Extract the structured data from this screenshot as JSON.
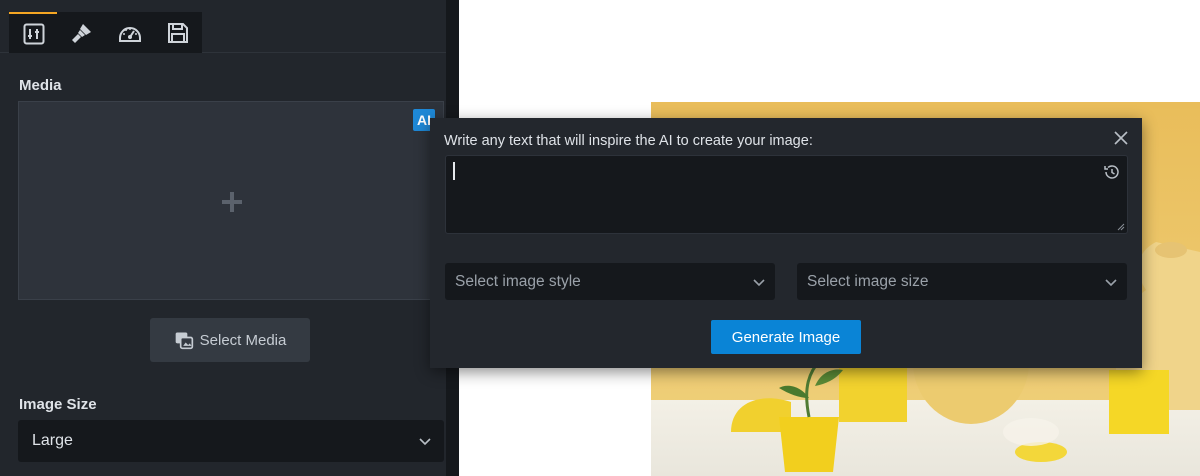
{
  "tabs": [
    {
      "icon": "settings-sliders-icon",
      "active": true
    },
    {
      "icon": "paintbrush-icon",
      "active": false
    },
    {
      "icon": "gauge-icon",
      "active": false
    },
    {
      "icon": "save-floppy-icon",
      "active": false
    }
  ],
  "media": {
    "label": "Media",
    "ai_badge": "AI",
    "select_button": "Select Media"
  },
  "image_size": {
    "label": "Image Size",
    "value": "Large"
  },
  "ai_popup": {
    "title": "Write any text that will inspire the AI to create your image:",
    "prompt_value": "",
    "style_placeholder": "Select image style",
    "size_placeholder": "Select image size",
    "generate_label": "Generate Image"
  },
  "colors": {
    "panel_bg": "#22262c",
    "accent_tab": "#f5a623",
    "ai_blue": "#1e88d6",
    "generate_blue": "#0a84d6"
  }
}
